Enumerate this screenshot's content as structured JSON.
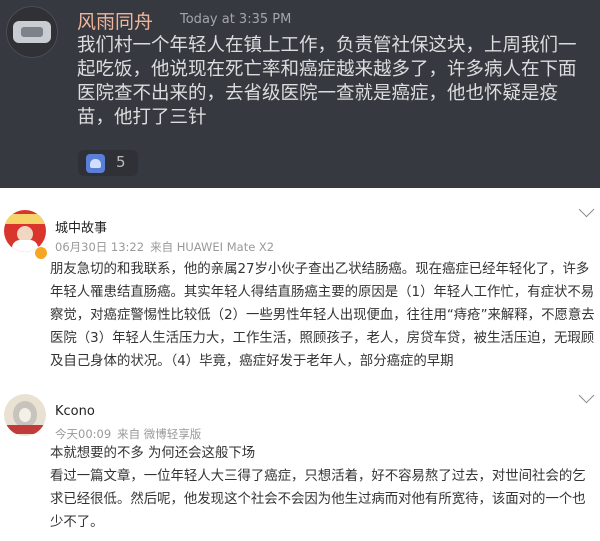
{
  "discord": {
    "username": "风雨同舟",
    "timestamp": "Today at 3:35 PM",
    "message": "我们村一个年轻人在镇上工作，负责管社保这块，上周我们一起吃饭，他说现在死亡率和癌症越来越多了，许多病人在下面医院查不出来的，去省级医院一查就是癌症，他也怀疑是疫苗，他打了三针",
    "reaction": {
      "icon": "emoji-reaction-icon",
      "count": "5"
    }
  },
  "comments": [
    {
      "name": "城中故事",
      "date": "06月30日 13:22",
      "source": "来自 HUAWEI Mate X2",
      "text": "朋友急切的和我联系，他的亲属27岁小伙子查出乙状结肠癌。现在癌症已经年轻化了，许多年轻人罹患结直肠癌。其实年轻人得结直肠癌主要的原因是（1）年轻人工作忙，有症状不易察觉，对癌症警惕性比较低（2）一些男性年轻人出现便血，往往用“痔疮”来解释，不愿意去医院（3）年轻人生活压力大，工作生活，照顾孩子，老人，房贷车贷，被生活压迫，无瑕顾及自己身体的状况。（4）毕竟，癌症好发于老年人，部分癌症的早期"
    },
    {
      "name": "Kcono",
      "date": "今天00:09",
      "source": "来自 微博轻享版",
      "text_line1": "本就想要的不多 为何还会这般下场",
      "text_body": "看过一篇文章，一位年轻人大三得了癌症，只想活着，好不容易熬了过去，对世间社会的乞求已经很低。然后呢，他发现这个社会不会因为他生过病而对他有所宽待，该面对的一个也少不了。"
    }
  ]
}
